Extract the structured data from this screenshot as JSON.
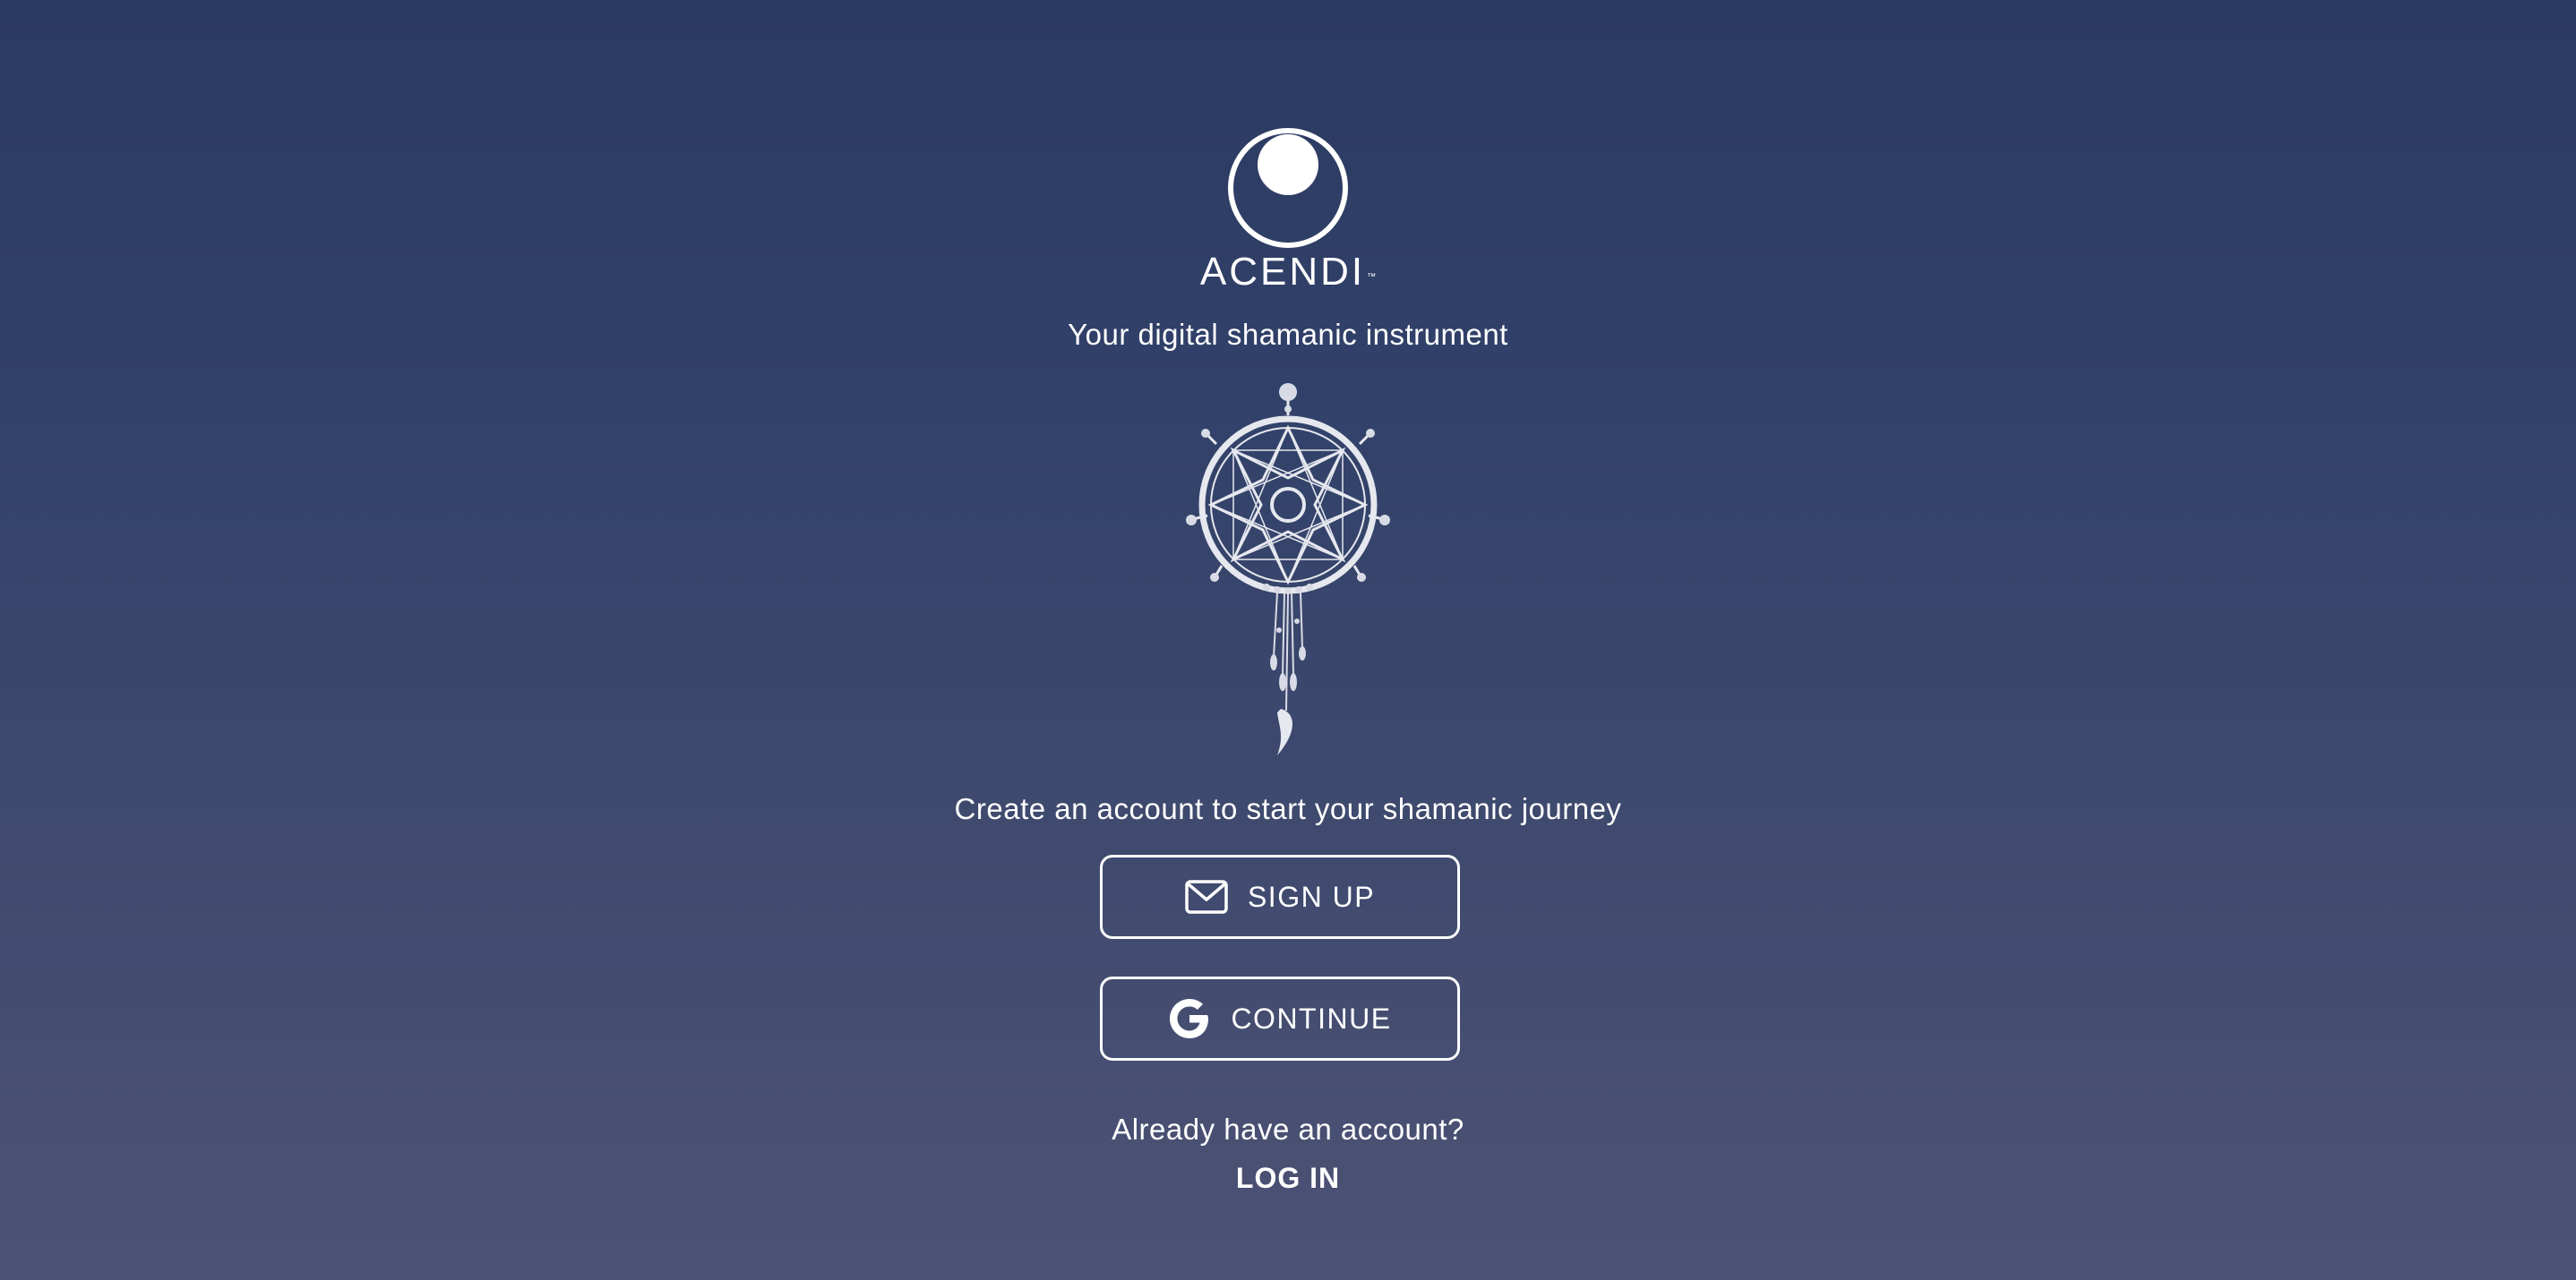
{
  "brand": {
    "name": "ACENDI",
    "trademark": "™",
    "logo_icon": "moon-circle-icon"
  },
  "tagline": "Your digital shamanic instrument",
  "illustration": {
    "icon": "dreamcatcher-icon"
  },
  "signup_prompt": "Create an account to start your shamanic journey",
  "buttons": {
    "signup": {
      "label": "SIGN UP",
      "icon": "mail-icon"
    },
    "google": {
      "label": "CONTINUE",
      "icon": "google-icon"
    }
  },
  "login_prompt": "Already have an account?",
  "login_link": "LOG IN",
  "colors": {
    "background_top": "#2b3a61",
    "background_bottom": "#4d5274",
    "foreground": "#ffffff"
  }
}
